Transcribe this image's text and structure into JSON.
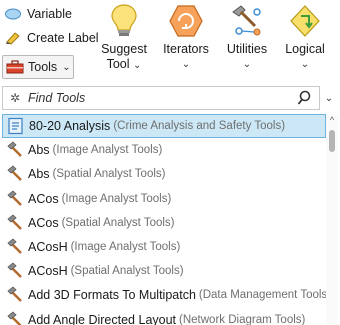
{
  "ribbon": {
    "variable_label": "Variable",
    "create_label_label": "Create Label",
    "tools_label": "Tools",
    "suggest_line1": "Suggest",
    "suggest_line2": "Tool",
    "iterators_label": "Iterators",
    "utilities_label": "Utilities",
    "logical_label": "Logical"
  },
  "search": {
    "placeholder": "Find Tools"
  },
  "tools": [
    {
      "name": "80-20 Analysis",
      "toolbox": "(Crime Analysis and Safety Tools)",
      "selected": true,
      "icon": "script-tool-icon"
    },
    {
      "name": "Abs",
      "toolbox": "(Image Analyst Tools)",
      "icon": "hammer-icon"
    },
    {
      "name": "Abs",
      "toolbox": "(Spatial Analyst Tools)",
      "icon": "hammer-icon"
    },
    {
      "name": "ACos",
      "toolbox": "(Image Analyst Tools)",
      "icon": "hammer-icon"
    },
    {
      "name": "ACos",
      "toolbox": "(Spatial Analyst Tools)",
      "icon": "hammer-icon"
    },
    {
      "name": "ACosH",
      "toolbox": "(Image Analyst Tools)",
      "icon": "hammer-icon"
    },
    {
      "name": "ACosH",
      "toolbox": "(Spatial Analyst Tools)",
      "icon": "hammer-icon"
    },
    {
      "name": "Add 3D Formats To Multipatch",
      "toolbox": "(Data Management Tools)",
      "icon": "hammer-icon"
    },
    {
      "name": "Add Angle Directed Layout",
      "toolbox": "(Network Diagram Tools)",
      "icon": "hammer-icon"
    }
  ],
  "colors": {
    "selection_bg": "#cce8f7",
    "selection_border": "#6db4e0",
    "hammer_handle": "#b06a2c",
    "hammer_head": "#8a8a8a"
  }
}
